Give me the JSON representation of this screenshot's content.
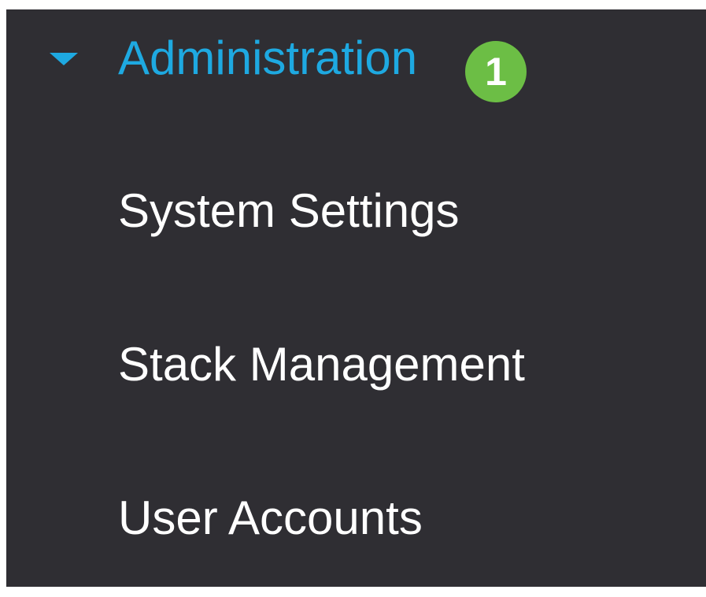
{
  "nav": {
    "section": {
      "label": "Administration",
      "badge": "1",
      "expanded": true,
      "icon": "caret-down-icon"
    },
    "items": [
      {
        "label": "System Settings"
      },
      {
        "label": "Stack Management"
      },
      {
        "label": "User Accounts"
      }
    ]
  },
  "colors": {
    "panel_background": "#2f2e33",
    "accent": "#1ea9e1",
    "badge": "#6cbe45",
    "item_text": "#ffffff"
  }
}
